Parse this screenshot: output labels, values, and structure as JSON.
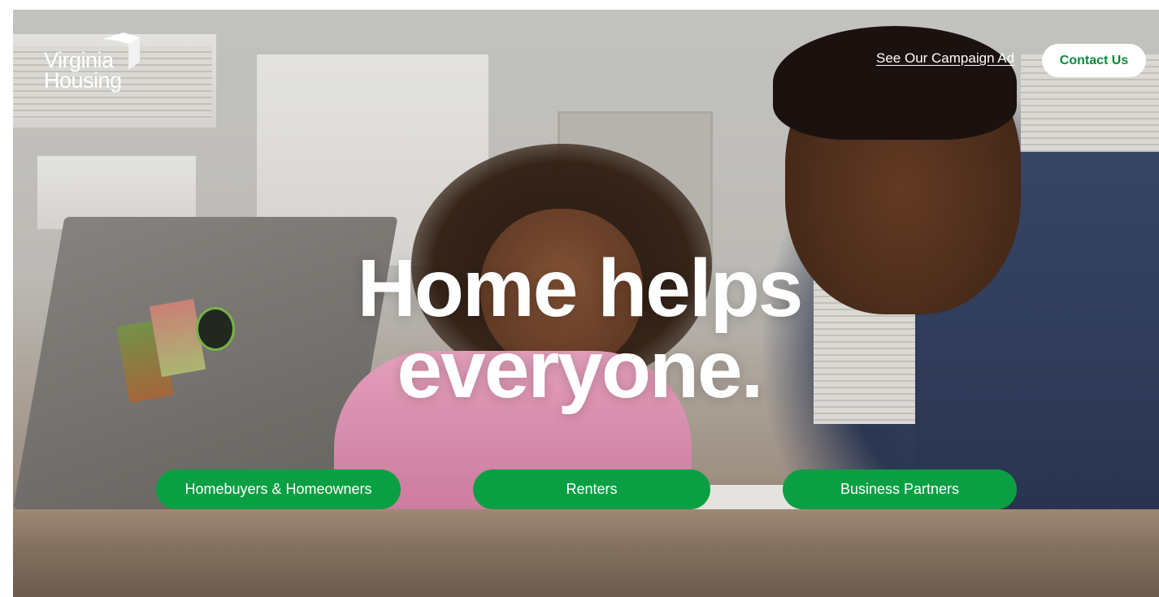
{
  "brand": {
    "line1": "Virginia",
    "line2": "Housing",
    "logo_icon": "cube-outline-icon"
  },
  "nav": {
    "campaign_link": "See Our Campaign Ad",
    "contact_button": "Contact Us"
  },
  "hero": {
    "line1": "Home helps",
    "line2": "everyone.",
    "image_alt": "Father and daughter working together at a kitchen counter"
  },
  "audiences": [
    {
      "label": "Homebuyers & Homeowners"
    },
    {
      "label": "Renters"
    },
    {
      "label": "Business Partners"
    }
  ],
  "colors": {
    "brand_green": "#0b9f43",
    "contact_text": "#0e8a3a",
    "white": "#ffffff"
  }
}
